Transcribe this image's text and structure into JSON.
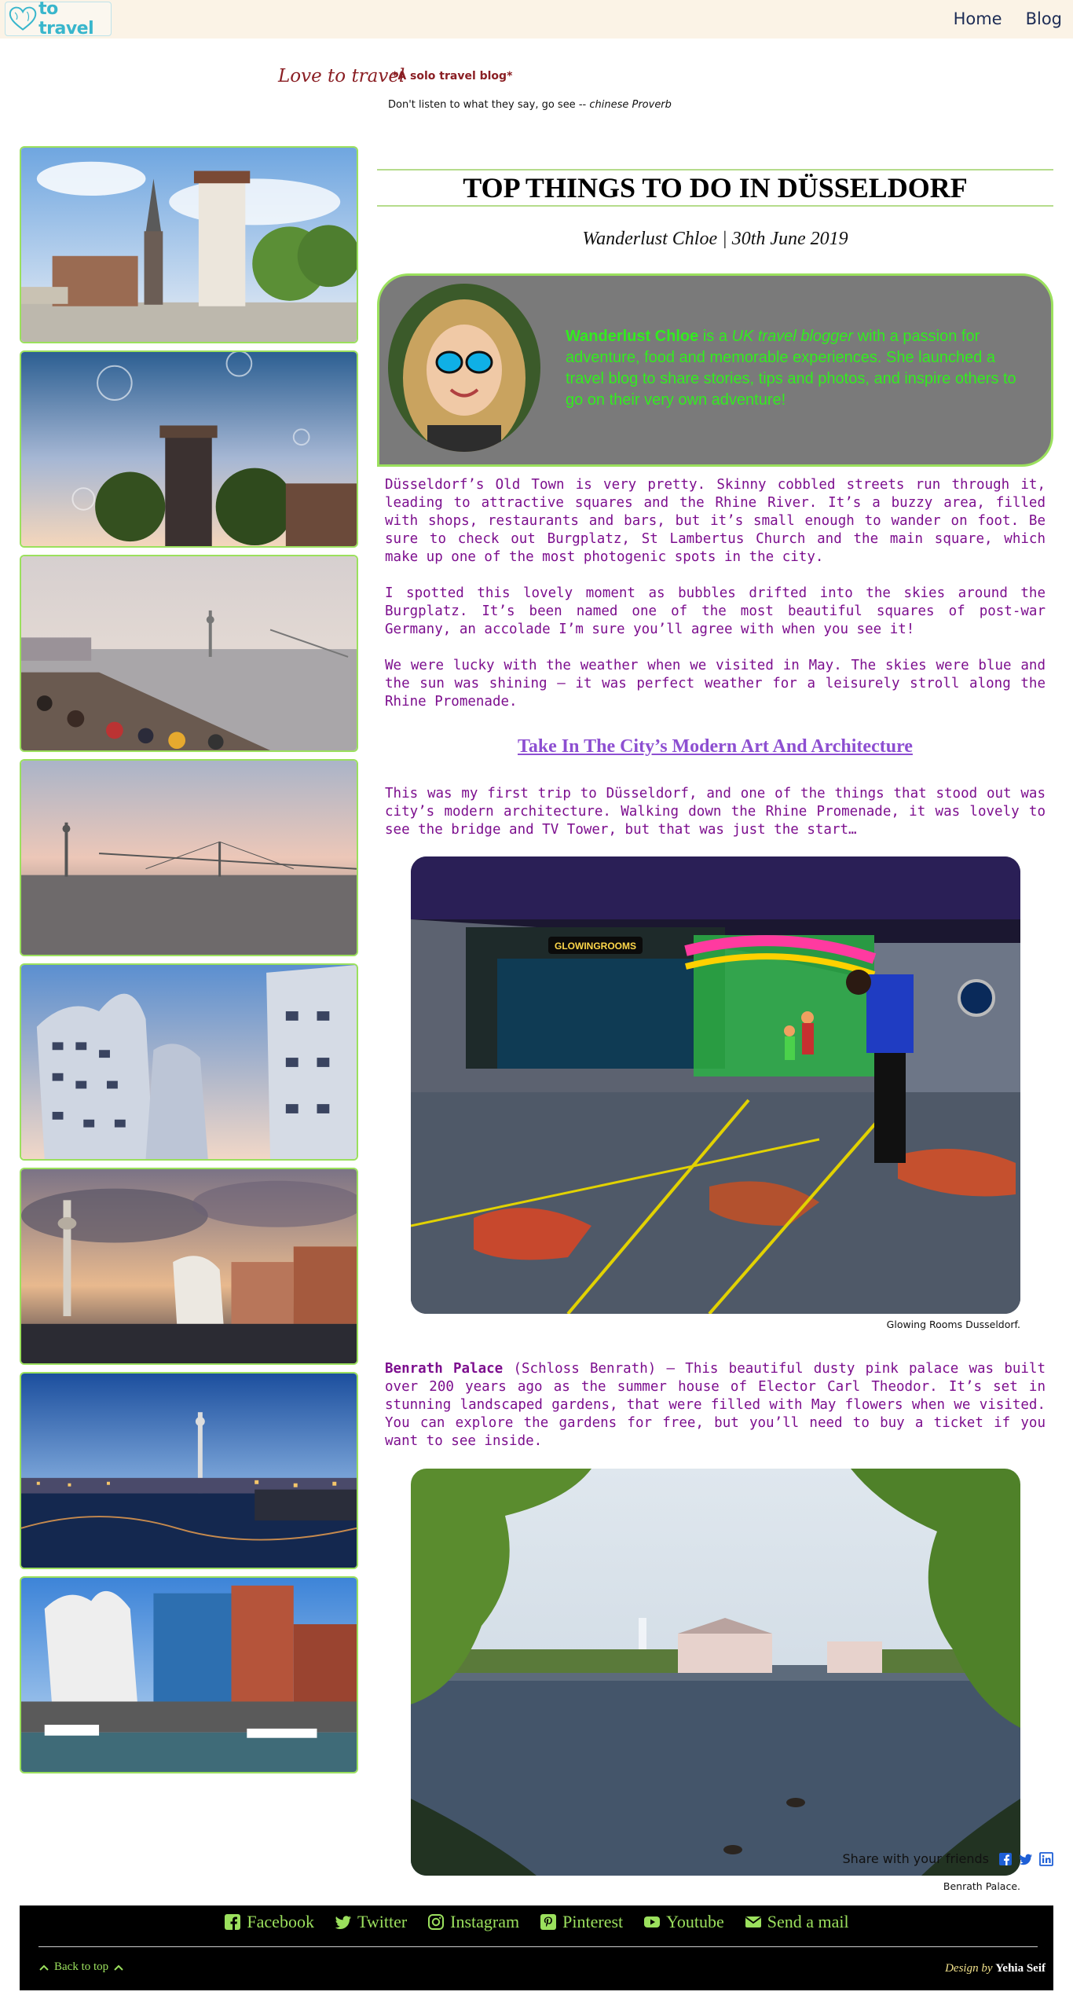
{
  "nav": {
    "logo_text": "to travel",
    "links": [
      "Home",
      "Blog"
    ]
  },
  "header": {
    "tagline": "Love to travel",
    "tagline_sub": "*A solo travel blog*",
    "proverb_text": "Don't listen to what they say, go see --",
    "proverb_source": "chinese Proverb"
  },
  "article": {
    "title": "TOP THINGS TO DO IN DÜSSELDORF",
    "byline": "Wanderlust Chloe | 30th June 2019",
    "author": {
      "name": "Wanderlust Chloe",
      "is_a": " is a ",
      "role": "UK travel blogger",
      "bio_rest": " with a passion for adventure, food and memorable experiences. She launched a travel blog to share stories, tips and photos, and inspire others to go on their very own adventure!"
    },
    "paragraphs": [
      "Düsseldorf’s Old Town is very pretty. Skinny cobbled streets run through it, leading to attractive squares and the Rhine River. It’s a buzzy area, filled with shops, restaurants and bars, but it’s small enough to wander on foot. Be sure to check out Burgplatz, St Lambertus Church and the main square, which make up one of the most photogenic spots in the city.",
      "I spotted this lovely moment as bubbles drifted into the skies around the Burgplatz. It’s been named one of the most beautiful squares of post-war Germany, an accolade I’m sure you’ll agree with when you see it!",
      "We were lucky with the weather when we visited in May. The skies were blue and the sun was shining – it was perfect weather for a leisurely stroll along the Rhine Promenade."
    ],
    "section_link": "Take In The City’s Modern Art And Architecture",
    "section_para": "This was my first trip to Düsseldorf, and one of the things that stood out was city’s modern architecture. Walking down the Rhine Promenade, it was lovely to see the bridge and TV Tower, but that was just the start…",
    "photo1_caption": "Glowing Rooms Dusseldorf.",
    "photo1_sign": "GLOWINGROOMS",
    "benrath_bold": "Benrath Palace",
    "benrath_text": " (Schloss Benrath) – This beautiful dusty pink palace was built over 200 years ago as the summer house of Elector Carl Theodor. It’s set in stunning landscaped gardens, that were filled with May flowers when we visited. You can explore the gardens for free, but you’ll need to buy a ticket if you want to see inside.",
    "photo2_caption": "Benrath Palace."
  },
  "share": {
    "label": "Share with your friends",
    "icons": [
      "facebook-icon",
      "twitter-icon",
      "linkedin-icon"
    ]
  },
  "footer": {
    "links": [
      "Facebook",
      "Twitter",
      "Instagram",
      "Pinterest",
      "Youtube",
      "Send a mail"
    ],
    "back_to_top": "Back to top",
    "design_by": "Design by",
    "designer": "Yehia Seif"
  },
  "colors": {
    "nav_bg": "#fbf3e6",
    "accent_green": "#9be05d",
    "text_purple": "#7c0e8e",
    "link_purple": "#8d4fd1",
    "bio_green": "#32ec1f",
    "box_gray": "#7a7a7a"
  }
}
